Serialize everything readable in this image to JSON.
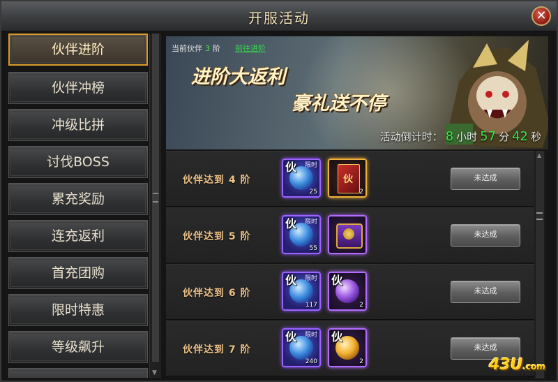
{
  "window": {
    "title": "开服活动",
    "close_glyph": "✕"
  },
  "sidebar": {
    "items": [
      {
        "label": "伙伴进阶",
        "active": true
      },
      {
        "label": "伙伴冲榜"
      },
      {
        "label": "冲级比拼"
      },
      {
        "label": "讨伐BOSS"
      },
      {
        "label": "累充奖励"
      },
      {
        "label": "连充返利"
      },
      {
        "label": "首充团购"
      },
      {
        "label": "限时特惠"
      },
      {
        "label": "等级飙升"
      }
    ]
  },
  "banner": {
    "current_label": "当前伙伴",
    "current_value": "3",
    "current_unit": "阶",
    "goto_link": "前往进阶",
    "slogan_line1": "进阶大返利",
    "slogan_line2": "豪礼送不停",
    "countdown_label": "活动倒计时：",
    "hours": "8",
    "hours_unit": "小时",
    "minutes": "57",
    "minutes_unit": "分",
    "seconds": "42",
    "seconds_unit": "秒"
  },
  "rewards": [
    {
      "label": "伙伴达到 4 阶",
      "item1": {
        "glyph": "伙",
        "tag": "限时",
        "count": "25"
      },
      "item2": {
        "kind": "book",
        "glyph": "伙",
        "count": "2"
      },
      "button": "未达成"
    },
    {
      "label": "伙伴达到 5 阶",
      "item1": {
        "glyph": "伙",
        "tag": "限时",
        "count": "55"
      },
      "item2": {
        "kind": "chest",
        "count": ""
      },
      "button": "未达成"
    },
    {
      "label": "伙伴达到 6 阶",
      "item1": {
        "glyph": "伙",
        "tag": "限时",
        "count": "117"
      },
      "item2": {
        "kind": "purple-orb",
        "glyph": "伙",
        "count": "2"
      },
      "button": "未达成"
    },
    {
      "label": "伙伴达到 7 阶",
      "item1": {
        "glyph": "伙",
        "tag": "限时",
        "count": "240"
      },
      "item2": {
        "kind": "gold-orb",
        "glyph": "伙",
        "count": "2"
      },
      "button": "未达成"
    }
  ],
  "watermark": {
    "text": "43U",
    "suffix": ".com"
  },
  "colors": {
    "accent_gold": "#d99a2b",
    "countdown_green": "#3ce84a",
    "label_orange": "#f0c38a"
  }
}
